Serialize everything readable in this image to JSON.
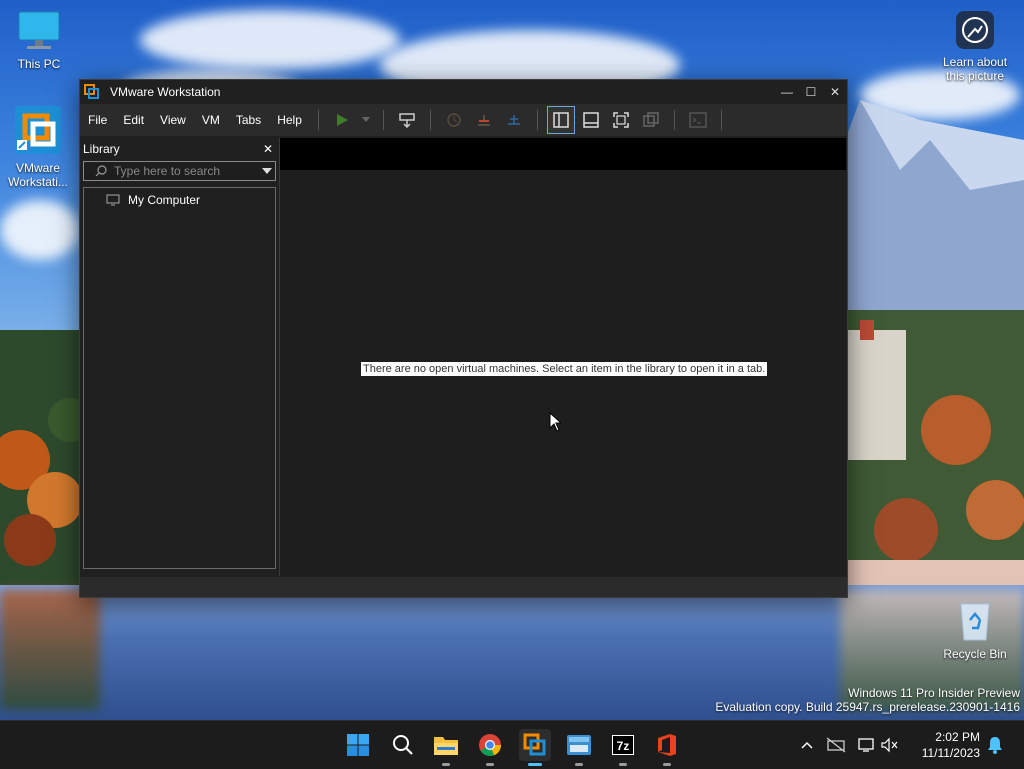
{
  "desktop": {
    "icons": [
      {
        "label": "This PC"
      },
      {
        "label": "VMware Workstati..."
      },
      {
        "label": "Learn about this picture"
      },
      {
        "label": "Recycle Bin"
      }
    ],
    "watermark": {
      "line1": "Windows 11 Pro Insider Preview",
      "line2": "Evaluation copy. Build 25947.rs_prerelease.230901-1416"
    }
  },
  "window": {
    "title": "VMware Workstation",
    "controls": {
      "minimize": "—",
      "maximize": "☐",
      "close": "✕"
    },
    "menu": [
      "File",
      "Edit",
      "View",
      "VM",
      "Tabs",
      "Help"
    ],
    "library": {
      "title": "Library",
      "close": "✕",
      "search_placeholder": "Type here to search",
      "items": [
        {
          "label": "My Computer"
        }
      ]
    },
    "empty_message": "There are no open virtual machines. Select an item in the library to open it in a tab.",
    "toolbar_icons": [
      "power-on-icon",
      "power-dropdown-icon",
      "send-ctrl-alt-del-icon",
      "snapshot-take-icon",
      "snapshot-revert-icon",
      "snapshot-manager-icon",
      "library-view-icon",
      "thumbnail-bar-icon",
      "full-screen-icon",
      "unity-icon",
      "console-view-icon"
    ]
  },
  "taskbar": {
    "apps": [
      "start-icon",
      "search-icon",
      "file-explorer-icon",
      "chrome-icon",
      "vmware-icon",
      "keyboard-app-icon",
      "7zip-icon",
      "office-icon"
    ],
    "clock": {
      "time": "2:02 PM",
      "date": "11/11/2023"
    }
  },
  "colors": {
    "accent": "#4cc2ff",
    "window_bg": "#202020",
    "menubar_bg": "#2b2b2b",
    "vmware_orange": "#f38b00",
    "vmware_blue": "#1d8fd6"
  }
}
